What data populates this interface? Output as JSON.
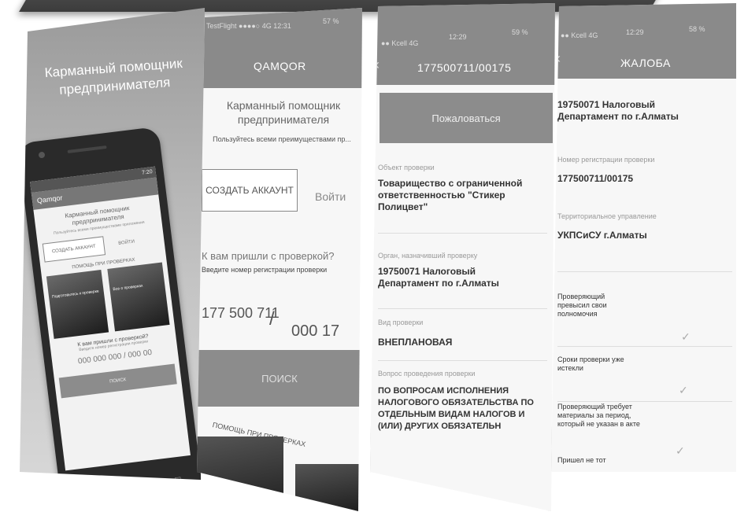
{
  "panel1": {
    "title": "Карманный помощник предпринимателя",
    "phone": {
      "status_time": "7:20",
      "app_name": "Qamqor",
      "title": "Карманный помощник предпринимателя",
      "subtitle": "Пользуйтесь всеми преимуществами приложения",
      "create_account": "СОЗДАТЬ АККАУНТ",
      "login": "ВОЙТИ",
      "help": "ПОМОЩЬ ПРИ ПРОВЕРКАХ",
      "card1": "Подготовьтесь к проверке",
      "card2": "Все о проверках",
      "question": "К вам пришли с проверкой?",
      "question_hint": "Введите номер регистрации проверки",
      "number_placeholder": "000 000 000 / 000 00",
      "search": "ПОИСК"
    }
  },
  "panel2": {
    "status": "TestFlight ●●●●○ 4G  12:31",
    "battery": "57 %",
    "nav_title": "QAMQOR",
    "title": "Карманный помощник предпринимателя",
    "subtitle": "Пользуйтесь всеми преимуществами пр...",
    "create_account": "СОЗДАТЬ АККАУНТ",
    "login": "Войти",
    "question": "К вам пришли с проверкой?",
    "question_hint": "Введите номер регистрации проверки",
    "number_part1": "177 500 711",
    "slash": "/",
    "number_part2": "000 17",
    "search": "ПОИСК",
    "help": "ПОМОЩЬ ПРИ ПРОВЕРКАХ"
  },
  "panel3": {
    "status": "●● Kcell  4G",
    "time": "12:29",
    "battery": "59 %",
    "nav_title": "177500711/00175",
    "complain": "Пожаловаться",
    "fields": [
      {
        "label": "Объект проверки",
        "value": "Товарищество с ограниченной ответственностью \"Стикер Полицвет\""
      },
      {
        "label": "Орган, назначивший проверку",
        "value": "19750071 Налоговый Департамент по г.Алматы"
      },
      {
        "label": "Вид проверки",
        "value": "ВНЕПЛАНОВАЯ"
      },
      {
        "label": "Вопрос проведения проверки",
        "value": "ПО ВОПРОСАМ ИСПОЛНЕНИЯ НАЛОГОВОГО ОБЯЗАТЕЛЬСТВА ПО ОТДЕЛЬНЫМ ВИДАМ НАЛОГОВ И (ИЛИ) ДРУГИХ ОБЯЗАТЕЛЬН"
      }
    ]
  },
  "panel4": {
    "status": "●● Kcell  4G",
    "time": "12:29",
    "battery": "58 %",
    "nav_title": "ЖАЛОБА",
    "org_value": "19750071 Налоговый Департамент по г.Алматы",
    "reg_label": "Номер регистрации проверки",
    "reg_value": "177500711/00175",
    "terr_label": "Территориальное управление",
    "terr_value": "УКПСиСУ г.Алматы",
    "checks": [
      "Проверяющий превысил свои полномочия",
      "Сроки проверки уже истекли",
      "Проверяющий требует материалы за период, который не указан в акте",
      "Пришел не тот"
    ]
  }
}
